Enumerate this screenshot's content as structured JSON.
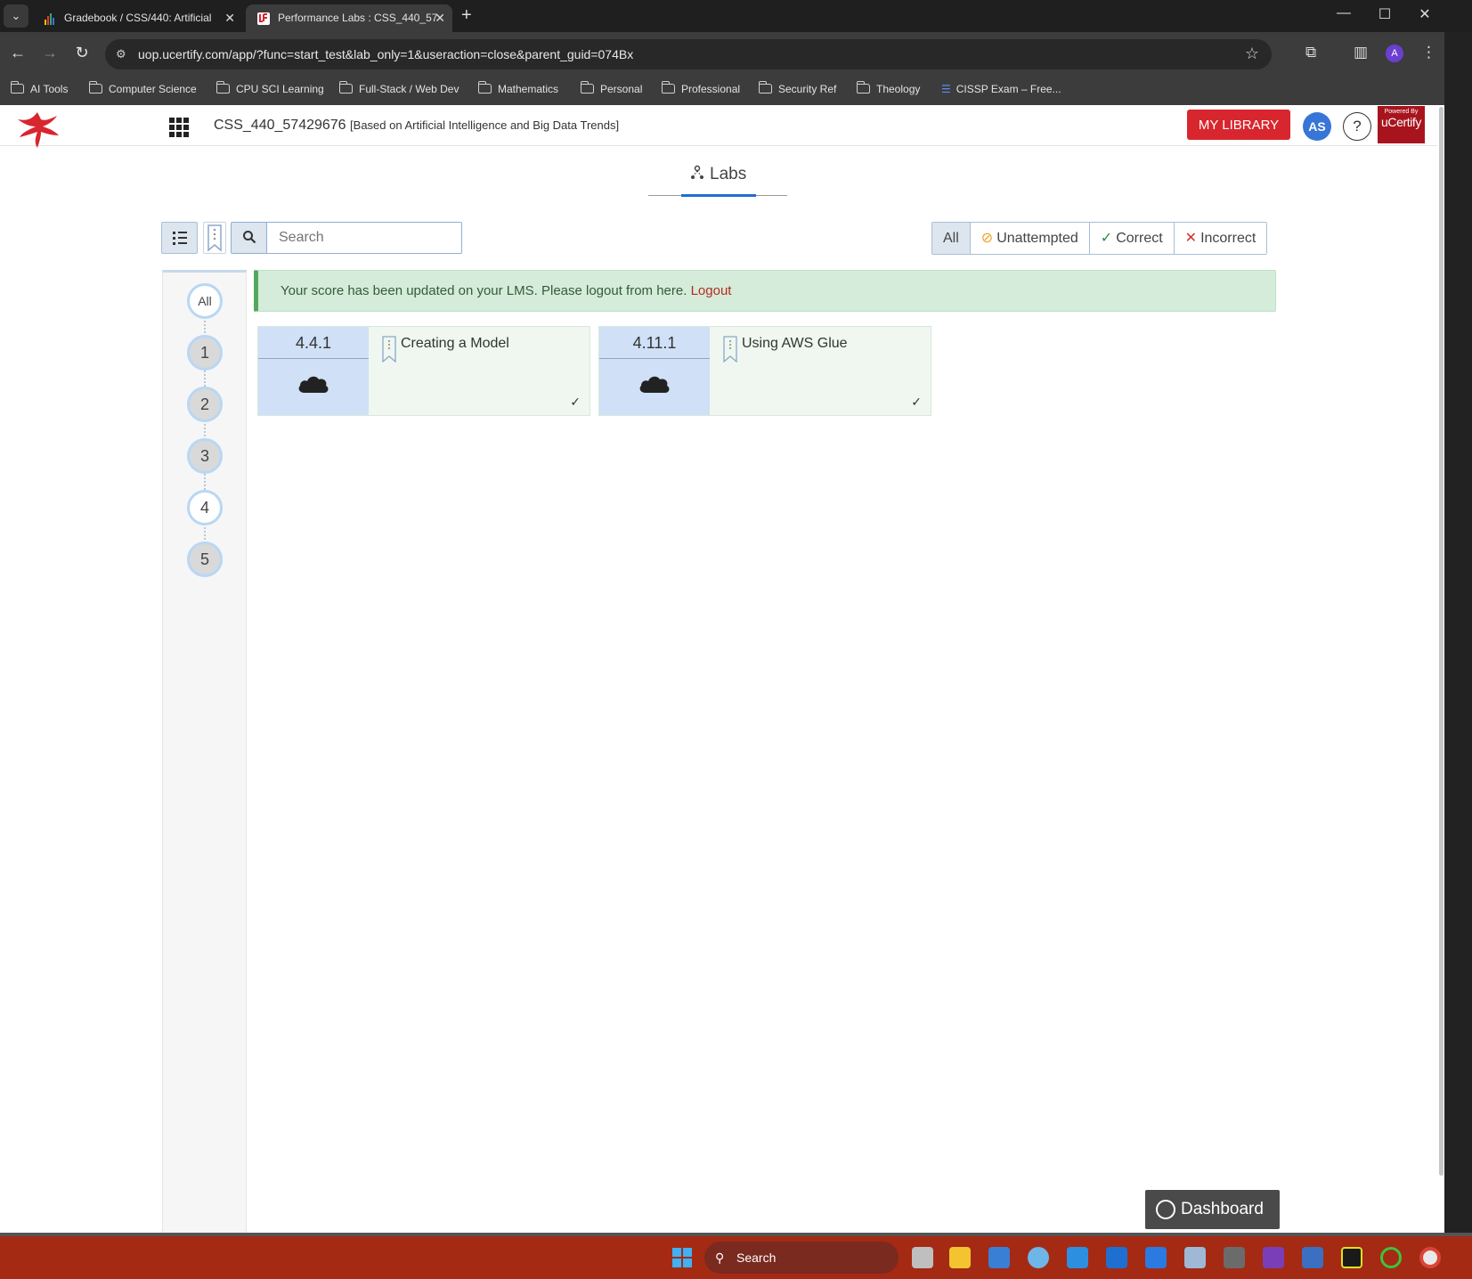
{
  "browser": {
    "tabs": [
      {
        "title": "Gradebook / CSS/440: Artificial",
        "active": false
      },
      {
        "title": "Performance Labs : CSS_440_57",
        "active": true
      }
    ],
    "url": "uop.ucertify.com/app/?func=start_test&lab_only=1&useraction=close&parent_guid=074Bx",
    "profile_initial": "A",
    "bookmarks": [
      {
        "label": "AI Tools",
        "icon": "folder-icon"
      },
      {
        "label": "Computer Science",
        "icon": "folder-icon"
      },
      {
        "label": "CPU SCI Learning",
        "icon": "folder-icon"
      },
      {
        "label": "Full-Stack / Web Dev",
        "icon": "folder-icon"
      },
      {
        "label": "Mathematics",
        "icon": "folder-icon"
      },
      {
        "label": "Personal",
        "icon": "folder-icon"
      },
      {
        "label": "Professional",
        "icon": "folder-icon"
      },
      {
        "label": "Security Ref",
        "icon": "folder-icon"
      },
      {
        "label": "Theology",
        "icon": "folder-icon"
      },
      {
        "label": "CISSP Exam – Free...",
        "icon": "list-icon"
      }
    ]
  },
  "app": {
    "course_code": "CSS_440_57429676",
    "course_subtitle": "[Based on Artificial Intelligence and Big Data Trends]",
    "my_library_label": "MY LIBRARY",
    "avatar_initials": "AS",
    "help_label": "?",
    "brand_powered_by": "Powered By",
    "brand_name": "uCertify",
    "brand_color": "#d8262e"
  },
  "labs": {
    "heading": "Labs",
    "search_placeholder": "Search",
    "filters": [
      {
        "label": "All",
        "icon": "",
        "color": "#444444"
      },
      {
        "label": "Unattempted",
        "icon": "eye-slash-icon",
        "color": "#f0a020"
      },
      {
        "label": "Correct",
        "icon": "check-icon",
        "color": "#2e8b3e"
      },
      {
        "label": "Incorrect",
        "icon": "x-icon",
        "color": "#d32f2f"
      }
    ],
    "chapters": [
      "All",
      "1",
      "2",
      "3",
      "4",
      "5"
    ],
    "alert_text": "Your score has been updated on your LMS. Please logout from here.",
    "alert_link": "Logout",
    "items": [
      {
        "number": "4.4.1",
        "title": "Creating a Model",
        "status": "correct"
      },
      {
        "number": "4.11.1",
        "title": "Using AWS Glue",
        "status": "correct"
      }
    ],
    "dashboard_label": "Dashboard"
  },
  "taskbar": {
    "search_placeholder": "Search"
  }
}
